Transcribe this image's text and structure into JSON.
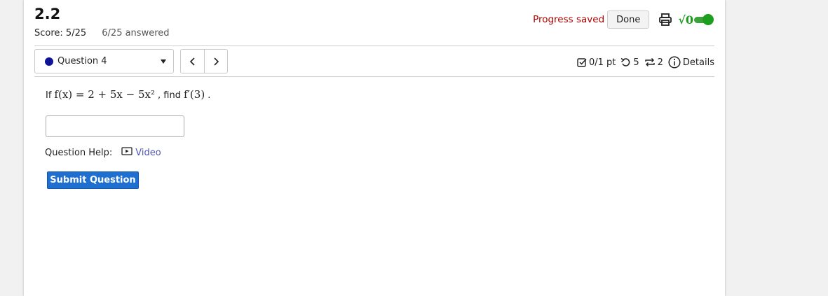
{
  "header": {
    "title": "2.2",
    "score": "Score: 5/25",
    "answered": "6/25 answered",
    "progress_saved": "Progress saved",
    "done_label": "Done",
    "print_icon": "print-icon",
    "math_toggle_label": "√0",
    "math_toggle_on": true,
    "accent_color": "#1e9e1e",
    "progress_color": "#b00000"
  },
  "question_nav": {
    "selected": "Question 4",
    "status_color": "#0d1596",
    "prev_icon": "chevron-left-icon",
    "next_icon": "chevron-right-icon"
  },
  "meta": {
    "points": "0/1 pt",
    "attempts": "5",
    "tries": "2",
    "details_label": "Details"
  },
  "question": {
    "prefix": "If",
    "function_expr": "f(x) = 2 + 5x − 5x²",
    "mid": ", find",
    "target_expr": "f′(3)",
    "suffix": ".",
    "answer_value": ""
  },
  "help": {
    "label": "Question Help:",
    "video_label": "Video",
    "link_color": "#4d56b0"
  },
  "submit": {
    "label": "Submit Question",
    "color": "#1f6fd1"
  }
}
